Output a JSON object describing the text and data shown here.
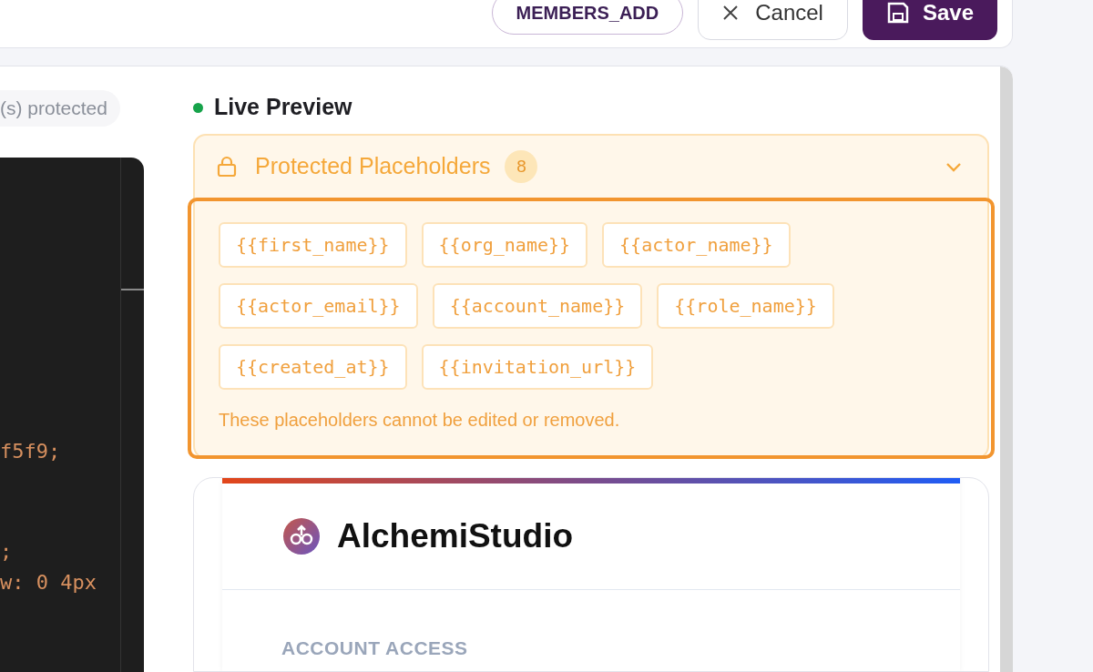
{
  "toolbar": {
    "buttons": [
      {
        "label": "MEMBERS_ADD",
        "kind": "tag"
      },
      {
        "label": "Cancel",
        "kind": "cancel"
      },
      {
        "label": "Save",
        "kind": "save"
      }
    ]
  },
  "editor": {
    "badge": "(s) protected",
    "code_lines": [
      {
        "text": "f5f9;"
      },
      {
        "text": ";"
      },
      {
        "text": "w: 0 4px"
      }
    ]
  },
  "preview": {
    "title": "Live Preview",
    "live": true,
    "placeholders": {
      "title": "Protected Placeholders",
      "count": "8",
      "expanded": true,
      "focused": true,
      "items": [
        "{{first_name}}",
        "{{org_name}}",
        "{{actor_name}}",
        "{{actor_email}}",
        "{{account_name}}",
        "{{role_name}}",
        "{{created_at}}",
        "{{invitation_url}}"
      ],
      "note": "These placeholders cannot be edited or removed."
    },
    "email": {
      "brand": "AlchemiStudio",
      "section_label": "ACCOUNT ACCESS"
    }
  }
}
